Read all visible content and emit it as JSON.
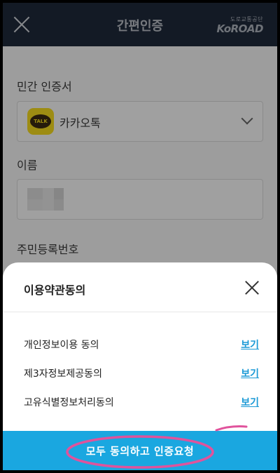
{
  "header": {
    "title": "간편인증",
    "logo_sub": "도로교통공단",
    "logo_main": "KoROAD"
  },
  "form": {
    "cert_label": "민간 인증서",
    "cert_value": "카카오톡",
    "talk_badge": "TALK",
    "name_label": "이름",
    "rrn_label": "주민등록번호"
  },
  "sheet": {
    "title": "이용약관동의",
    "terms": [
      {
        "label": "개인정보이용 동의",
        "link": "보기"
      },
      {
        "label": "제3자정보제공동의",
        "link": "보기"
      },
      {
        "label": "고유식별정보처리동의",
        "link": "보기"
      }
    ],
    "cta_label": "모두 동의하고 인증요청"
  },
  "colors": {
    "header_bg": "#1f2a3a",
    "accent": "#1aa7e0",
    "link": "#1b9ad6",
    "kakao_yellow": "#f6dc1e",
    "annotation": "#e0539c"
  }
}
